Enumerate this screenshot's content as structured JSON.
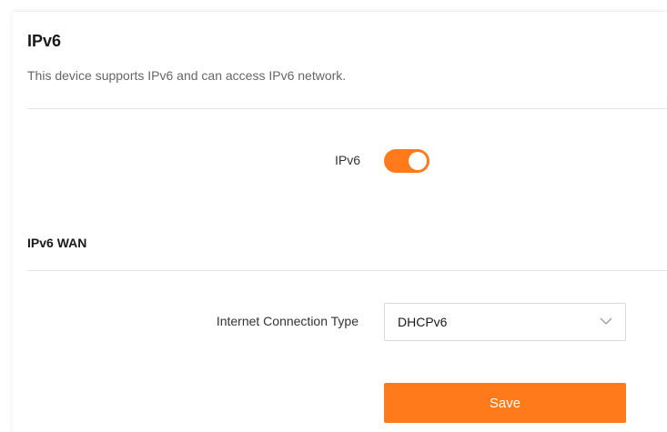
{
  "header": {
    "title": "IPv6",
    "description": "This device supports IPv6 and can access IPv6 network."
  },
  "ipv6_toggle": {
    "label": "IPv6",
    "enabled": true
  },
  "wan_section": {
    "title": "IPv6 WAN",
    "connection_type_label": "Internet Connection Type",
    "connection_type_value": "DHCPv6"
  },
  "actions": {
    "save_label": "Save"
  },
  "colors": {
    "accent": "#ff7a1a",
    "text_primary": "#1a1a1a",
    "text_secondary": "#666666",
    "divider": "#e6e6e6"
  },
  "icons": {
    "select_indicator": "chevron-down-icon"
  }
}
